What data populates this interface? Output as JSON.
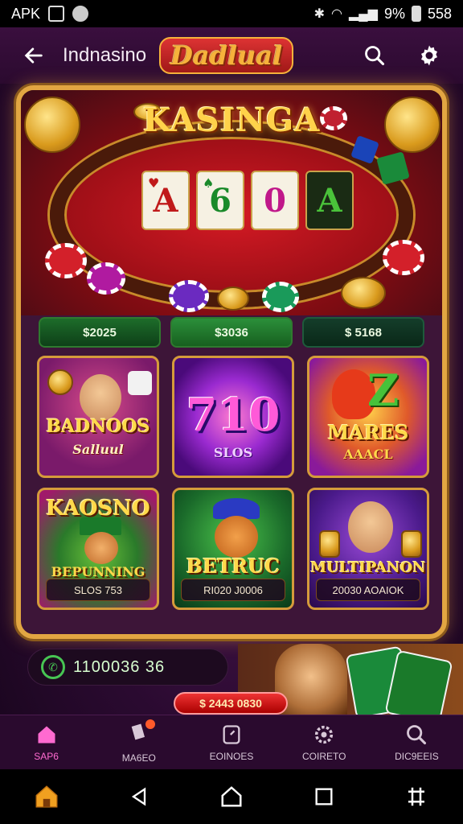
{
  "status_bar": {
    "carrier": "APK",
    "battery": "9%",
    "time": "558"
  },
  "header": {
    "title": "Indnasino",
    "logo_text": "Dadlual"
  },
  "hero": {
    "title": "KASINGA",
    "cards": [
      "A",
      "6",
      "0",
      "A"
    ]
  },
  "amounts": [
    "$2025",
    "$3036",
    "$ 5168"
  ],
  "games": [
    {
      "title": "BADNOOS",
      "subtitle": "Salluul",
      "footer": ""
    },
    {
      "title": "710",
      "subtitle": "SLOS",
      "footer": ""
    },
    {
      "title": "MARES",
      "subtitle": "AAACL",
      "footer": ""
    },
    {
      "title": "KAOSNO",
      "subtitle": "BEPUNNING",
      "footer": "SLOS 753"
    },
    {
      "title": "BETRUC",
      "subtitle": "",
      "footer": "RI020 J0006"
    },
    {
      "title": "MULTIPANON",
      "subtitle": "",
      "footer": "20030 AOAIOK"
    }
  ],
  "balance": {
    "amount": "1100036 36"
  },
  "jackpot": "$ 2443 0830",
  "bottom_nav": [
    {
      "label": "SAP6",
      "icon": "home-icon",
      "active": true
    },
    {
      "label": "MA6EO",
      "icon": "cards-icon",
      "active": false
    },
    {
      "label": "EOINOES",
      "icon": "tablet-icon",
      "active": false
    },
    {
      "label": "COIRETO",
      "icon": "gear-icon",
      "active": false
    },
    {
      "label": "DIC9EEIS",
      "icon": "search-icon",
      "active": false
    }
  ],
  "colors": {
    "accent_gold": "#e2a642",
    "background": "#2a0a30",
    "nav_active": "#ff6ad0"
  }
}
